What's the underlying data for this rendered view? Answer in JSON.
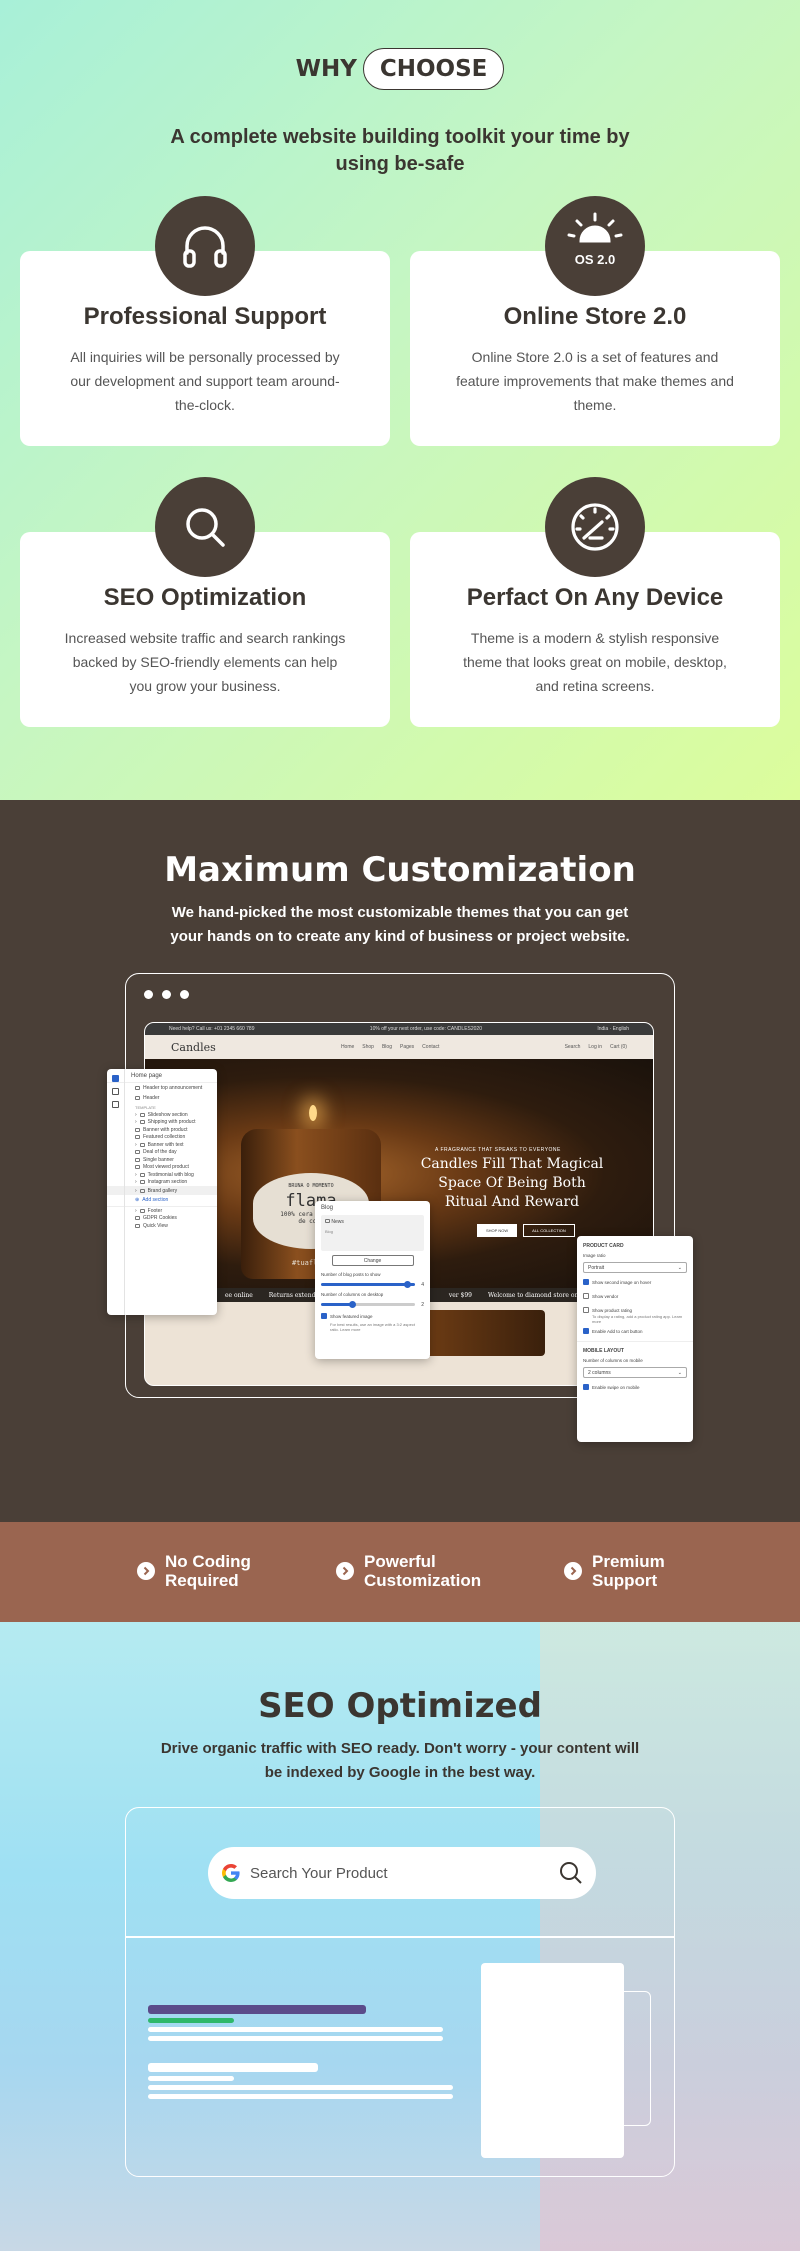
{
  "why": {
    "word1": "WHY",
    "word2": "CHOOSE"
  },
  "intro": "A complete website building toolkit your time by using be-safe",
  "cards": [
    {
      "icon": "headphones-icon",
      "title": "Professional Support",
      "text": "All inquiries will be personally processed by our development and support team around-the-clock."
    },
    {
      "icon": "sun-icon",
      "badge": "OS 2.0",
      "title": "Online Store 2.0",
      "text": "Online Store 2.0 is a set of features and feature improvements that make themes and theme."
    },
    {
      "icon": "search-icon",
      "title": "SEO Optimization",
      "text": "Increased website traffic and search rankings backed by SEO-friendly elements can help you grow your business."
    },
    {
      "icon": "speedometer-icon",
      "title": "Perfact On Any Device",
      "text": "Theme is a modern & stylish responsive theme that looks great on mobile, desktop, and retina screens."
    }
  ],
  "custom": {
    "title": "Maximum Customization",
    "subtitle": "We hand-picked the most customizable themes that you can get your hands on to create any kind of business or project website."
  },
  "mock": {
    "topbar_left": "Need help? Call us: +01 2345 660 789",
    "topbar_center": "10% off your next order, use code: CANDLES2020",
    "topbar_right": "India · English",
    "logo": "Candles",
    "nav": [
      "Home",
      "Shop",
      "Blog",
      "Pages",
      "Contact"
    ],
    "nav_right": [
      "Search",
      "Log in",
      "Cart (0)"
    ],
    "label_line1": "BRUNA O MOMENTO",
    "label_brand": "flama",
    "label_line2": "100% cera vegetal",
    "label_line3": "de coco",
    "label_tag": "#tuaflama",
    "hero_small": "A FRAGRANCE THAT SPEAKS TO EVERYONE",
    "hero_title": "Candles Fill That Magical Space Of Being Both Ritual And Reward",
    "hero_btn1": "SHOP NOW",
    "hero_btn2": "ALL COLLECTION",
    "ticker": [
      "ee online",
      "Returns extended",
      "ver $99",
      "Welcome to diamond store online"
    ]
  },
  "editor": {
    "title": "Home page",
    "items": [
      "Header top announcement",
      "Header",
      "TEMPLATE",
      "Slideshow section",
      "Shipping with product",
      "Banner with product",
      "Featured collection",
      "Banner with text",
      "Deal of the day",
      "Single banner",
      "Most viewed product",
      "Testimonial with blog",
      "Instagram section",
      "Brand gallery",
      "Add section",
      "Footer",
      "GDPR Cookies",
      "Quick View"
    ]
  },
  "blog_panel": {
    "title": "Blog",
    "item": "News",
    "sub": "Blog",
    "change": "Change",
    "posts_label": "Number of blog posts to show",
    "posts_val": "4",
    "cols_label": "Number of columns on desktop",
    "cols_val": "2",
    "featured": "Show featured image",
    "note": "For best results, use an image with a 3:2 aspect ratio. Learn more"
  },
  "card_panel": {
    "title": "PRODUCT CARD",
    "ratio_label": "Image ratio",
    "ratio_val": "Portrait",
    "opt1": "Show second image on hover",
    "opt2": "Show vendor",
    "opt3": "Show product rating",
    "opt3_note": "To display a rating, add a product rating app. Learn more",
    "opt4": "Enable Add to cart button",
    "mobile": "MOBILE LAYOUT",
    "cols_label": "Number of columns on mobile",
    "cols_val": "2 columns",
    "swipe": "Enable swipe on mobile"
  },
  "features": [
    {
      "line1": "No Coding",
      "line2": "Required"
    },
    {
      "line1": "Powerful",
      "line2": "Customization"
    },
    {
      "line1": "Premium",
      "line2": "Support"
    }
  ],
  "seo": {
    "title": "SEO Optimized",
    "subtitle": "Drive organic traffic with SEO ready.  Don't worry - your content will be indexed by Google in the best way.",
    "search_placeholder": "Search Your Product"
  },
  "colors": {
    "brown": "#4a3f37",
    "terracotta": "#9a6550",
    "accent_purple": "#5b4b8a",
    "accent_green": "#2fb86a"
  }
}
